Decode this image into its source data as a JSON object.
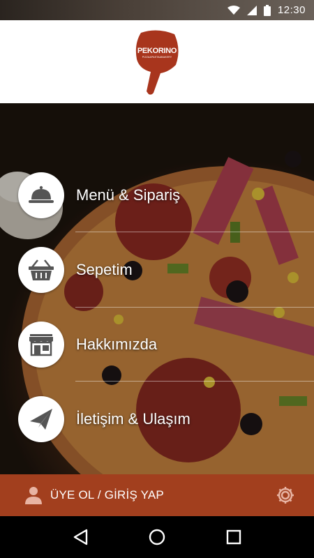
{
  "status_bar": {
    "time": "12:30",
    "icons": [
      "wifi-icon",
      "signal-icon",
      "battery-icon"
    ]
  },
  "header": {
    "logo_text": "PEKORINO",
    "logo_subtext": "PIZZA&PASTA&BAKERY",
    "colors": {
      "logo": "#a8351d",
      "background": "#ffffff"
    }
  },
  "menu": {
    "items": [
      {
        "label": "Menü & Sipariş",
        "icon": "cloche-icon"
      },
      {
        "label": "Sepetim",
        "icon": "basket-icon"
      },
      {
        "label": "Hakkımızda",
        "icon": "storefront-icon"
      },
      {
        "label": "İletişim & Ulaşım",
        "icon": "paper-plane-icon"
      }
    ]
  },
  "user_bar": {
    "login_label": "ÜYE OL / GİRİŞ YAP",
    "user_icon": "user-icon",
    "settings_icon": "gear-icon",
    "colors": {
      "background": "#a23f1e"
    }
  },
  "nav_bar": {
    "buttons": [
      "back-icon",
      "home-icon",
      "recents-icon"
    ]
  }
}
